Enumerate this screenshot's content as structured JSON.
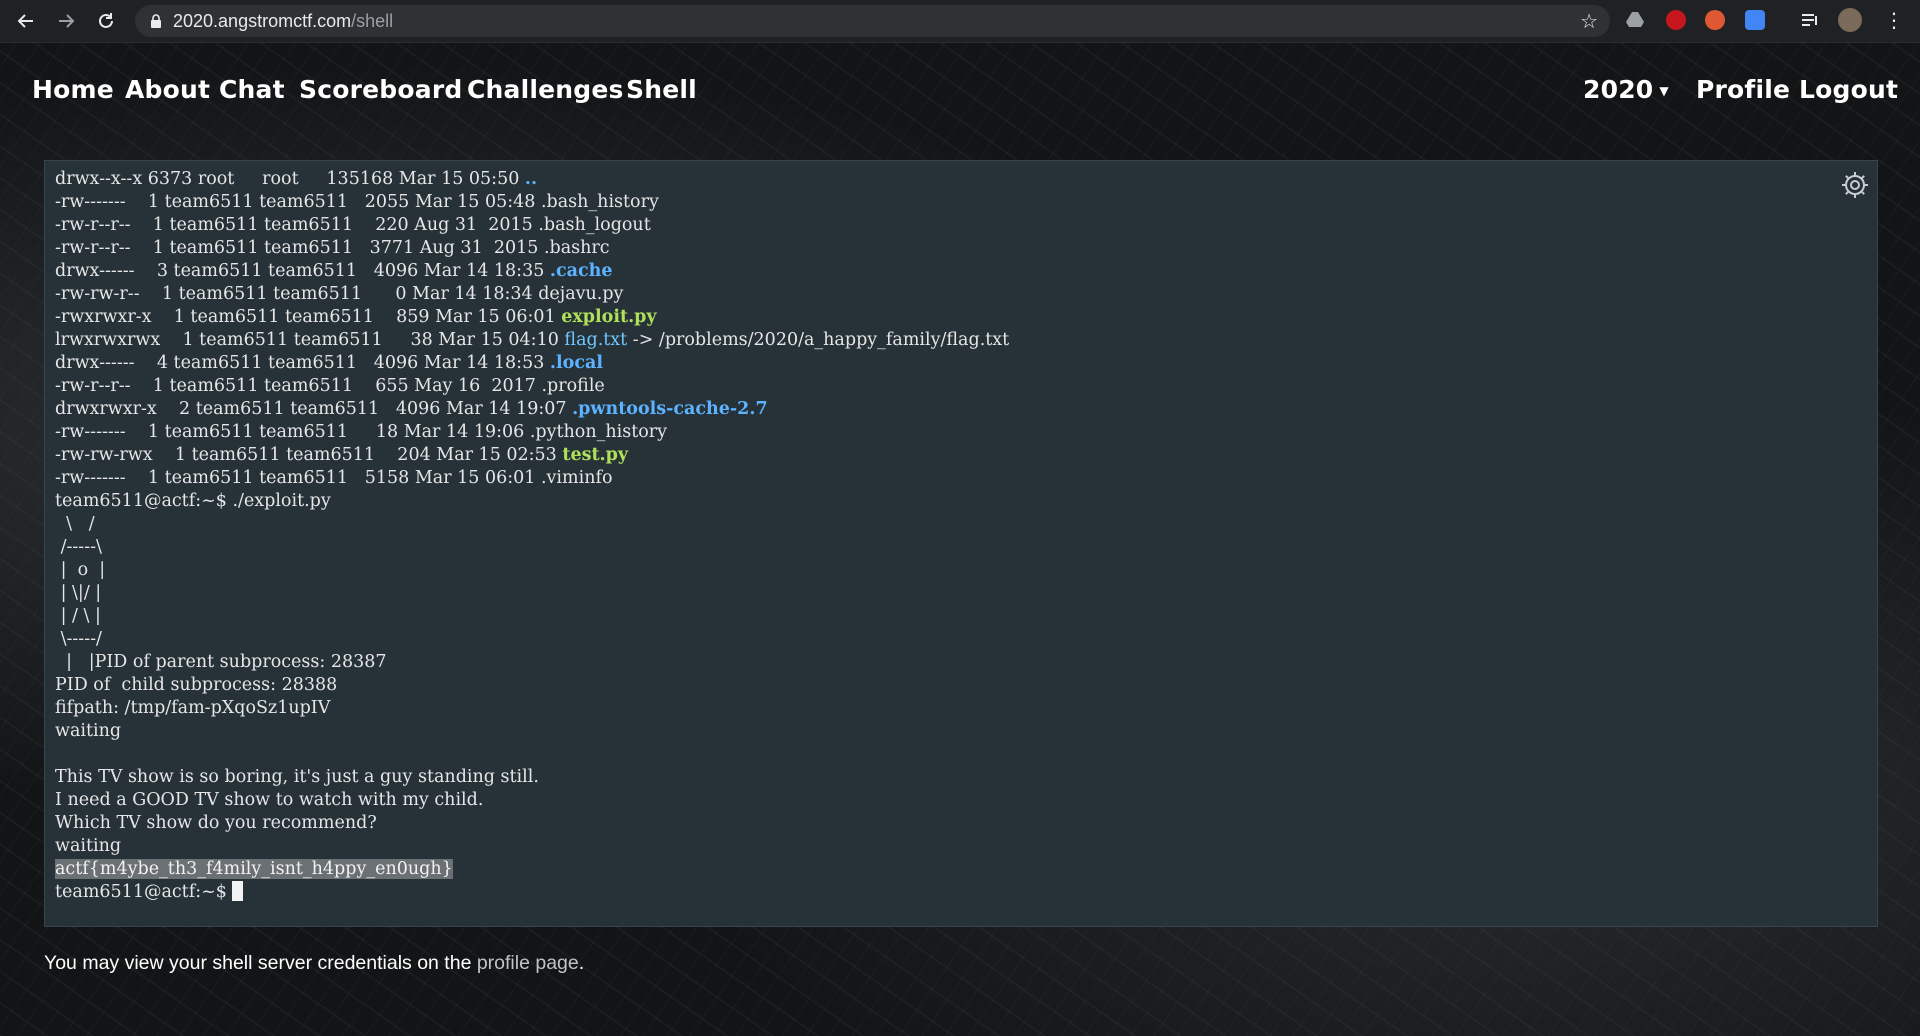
{
  "browser": {
    "url_host": "2020.angstromctf.com",
    "url_path": "/shell"
  },
  "site_nav": {
    "left": [
      "Home",
      "About",
      "Chat",
      "Scoreboard",
      "Challenges",
      "Shell"
    ],
    "year_dropdown": "2020",
    "profile": "Profile",
    "logout": "Logout"
  },
  "terminal": {
    "ls_rows": [
      {
        "perm": "drwx--x--x",
        "links": "6373",
        "user": "root",
        "group": "root",
        "size": "135168",
        "date": "Mar 15 05:50",
        "name": "..",
        "kind": "dir",
        "target": ""
      },
      {
        "perm": "-rw-------",
        "links": "1",
        "user": "team6511",
        "group": "team6511",
        "size": "2055",
        "date": "Mar 15 05:48",
        "name": ".bash_history",
        "kind": "file",
        "target": ""
      },
      {
        "perm": "-rw-r--r--",
        "links": "1",
        "user": "team6511",
        "group": "team6511",
        "size": "220",
        "date": "Aug 31  2015",
        "name": ".bash_logout",
        "kind": "file",
        "target": ""
      },
      {
        "perm": "-rw-r--r--",
        "links": "1",
        "user": "team6511",
        "group": "team6511",
        "size": "3771",
        "date": "Aug 31  2015",
        "name": ".bashrc",
        "kind": "file",
        "target": ""
      },
      {
        "perm": "drwx------",
        "links": "3",
        "user": "team6511",
        "group": "team6511",
        "size": "4096",
        "date": "Mar 14 18:35",
        "name": ".cache",
        "kind": "dir",
        "target": ""
      },
      {
        "perm": "-rw-rw-r--",
        "links": "1",
        "user": "team6511",
        "group": "team6511",
        "size": "0",
        "date": "Mar 14 18:34",
        "name": "dejavu.py",
        "kind": "file",
        "target": ""
      },
      {
        "perm": "-rwxrwxr-x",
        "links": "1",
        "user": "team6511",
        "group": "team6511",
        "size": "859",
        "date": "Mar 15 06:01",
        "name": "exploit.py",
        "kind": "exe",
        "target": ""
      },
      {
        "perm": "lrwxrwxrwx",
        "links": "1",
        "user": "team6511",
        "group": "team6511",
        "size": "38",
        "date": "Mar 15 04:10",
        "name": "flag.txt",
        "kind": "link",
        "target": " -> /problems/2020/a_happy_family/flag.txt"
      },
      {
        "perm": "drwx------",
        "links": "4",
        "user": "team6511",
        "group": "team6511",
        "size": "4096",
        "date": "Mar 14 18:53",
        "name": ".local",
        "kind": "dir",
        "target": ""
      },
      {
        "perm": "-rw-r--r--",
        "links": "1",
        "user": "team6511",
        "group": "team6511",
        "size": "655",
        "date": "May 16  2017",
        "name": ".profile",
        "kind": "file",
        "target": ""
      },
      {
        "perm": "drwxrwxr-x",
        "links": "2",
        "user": "team6511",
        "group": "team6511",
        "size": "4096",
        "date": "Mar 14 19:07",
        "name": ".pwntools-cache-2.7",
        "kind": "dir",
        "target": ""
      },
      {
        "perm": "-rw-------",
        "links": "1",
        "user": "team6511",
        "group": "team6511",
        "size": "18",
        "date": "Mar 14 19:06",
        "name": ".python_history",
        "kind": "file",
        "target": ""
      },
      {
        "perm": "-rw-rw-rwx",
        "links": "1",
        "user": "team6511",
        "group": "team6511",
        "size": "204",
        "date": "Mar 15 02:53",
        "name": "test.py",
        "kind": "exe",
        "target": ""
      },
      {
        "perm": "-rw-------",
        "links": "1",
        "user": "team6511",
        "group": "team6511",
        "size": "5158",
        "date": "Mar 15 06:01",
        "name": ".viminfo",
        "kind": "file",
        "target": ""
      }
    ],
    "output_lines": [
      "team6511@actf:~$ ./exploit.py",
      "  \\   /",
      " /-----\\",
      " |  o  |",
      " | \\|/ |",
      " | / \\ |",
      " \\-----/",
      "  |   |PID of parent subprocess: 28387",
      "PID of  child subprocess: 28388",
      "fifpath: /tmp/fam-pXqoSz1upIV",
      "waiting",
      "",
      "This TV show is so boring, it's just a guy standing still.",
      "I need a GOOD TV show to watch with my child.",
      "Which TV show do you recommend?",
      "waiting"
    ],
    "flag_line": "actf{m4ybe_th3_f4mily_isnt_h4ppy_en0ugh}",
    "prompt": "team6511@actf:~$ "
  },
  "footer": {
    "before": "You may view your shell server credentials on the ",
    "link": "profile page",
    "after": "."
  }
}
